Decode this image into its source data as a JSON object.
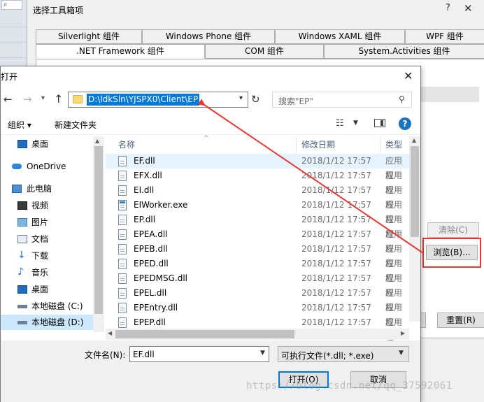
{
  "ide": {
    "search_glyph": "⌕"
  },
  "toolbox": {
    "title": "选择工具箱项",
    "help": "?",
    "close": "✕",
    "tabs_row1": [
      "Silverlight 组件",
      "Windows Phone 组件",
      "Windows XAML 组件",
      "WPF 组件"
    ],
    "tabs_row2": [
      ".NET Framework 组件",
      "COM 组件",
      "System.Activities 组件"
    ],
    "active_tab": ".NET Framework 组件",
    "clear_label": "清除(C)",
    "browse_label": "浏览(B)...",
    "reset_label": "重置(R)"
  },
  "open_dialog": {
    "title": "打开",
    "close": "✕",
    "path": "D:\\ldkSln\\YJSPX0\\Client\\EP",
    "search_placeholder": "搜索\"EP\"",
    "organize_label": "组织 ▾",
    "new_folder_label": "新建文件夹",
    "help_label": "?",
    "nav_items": [
      {
        "label": "桌面",
        "icon": "desktop-icon"
      },
      {
        "label": "OneDrive",
        "icon": "onedrive-icon"
      },
      {
        "label": "此电脑",
        "icon": "pc-icon"
      },
      {
        "label": "视频",
        "icon": "video-icon"
      },
      {
        "label": "图片",
        "icon": "picture-icon"
      },
      {
        "label": "文档",
        "icon": "document-icon"
      },
      {
        "label": "下载",
        "icon": "download-icon"
      },
      {
        "label": "音乐",
        "icon": "music-icon"
      },
      {
        "label": "桌面",
        "icon": "desktop-icon"
      },
      {
        "label": "本地磁盘 (C:)",
        "icon": "drive-icon"
      },
      {
        "label": "本地磁盘 (D:)",
        "icon": "drive-icon"
      }
    ],
    "columns": {
      "name": "名称",
      "date": "修改日期",
      "type": "类型"
    },
    "files": [
      {
        "name": "EF.dll",
        "date": "2018/1/12 17:57",
        "type": "应用程"
      },
      {
        "name": "EFX.dll",
        "date": "2018/1/12 17:57",
        "type": "应用程"
      },
      {
        "name": "EI.dll",
        "date": "2018/1/12 17:57",
        "type": "应用程"
      },
      {
        "name": "EIWorker.exe",
        "date": "2018/1/12 17:57",
        "type": "应用程"
      },
      {
        "name": "EP.dll",
        "date": "2018/1/12 17:57",
        "type": "应用程"
      },
      {
        "name": "EPEA.dll",
        "date": "2018/1/12 17:57",
        "type": "应用程"
      },
      {
        "name": "EPEB.dll",
        "date": "2018/1/12 17:57",
        "type": "应用程"
      },
      {
        "name": "EPED.dll",
        "date": "2018/1/12 17:57",
        "type": "应用程"
      },
      {
        "name": "EPEDMSG.dll",
        "date": "2018/1/12 17:57",
        "type": "应用程"
      },
      {
        "name": "EPEL.dll",
        "date": "2018/1/12 17:57",
        "type": "应用程"
      },
      {
        "name": "EPEntry.dll",
        "date": "2018/1/12 17:57",
        "type": "应用程"
      },
      {
        "name": "EPEP.dll",
        "date": "2018/1/12 17:57",
        "type": "应用程"
      }
    ],
    "filename_label": "文件名(N):",
    "filename_value": "EF.dll",
    "filetype_value": "可执行文件(*.dll; *.exe)",
    "open_label": "打开(O)",
    "cancel_label": "取消"
  },
  "watermark": "https://blog.csdn.net/qq_37592061",
  "colors": {
    "selection": "#0078d7",
    "annotation": "#e53935",
    "nav_selected": "#cce8ff"
  }
}
